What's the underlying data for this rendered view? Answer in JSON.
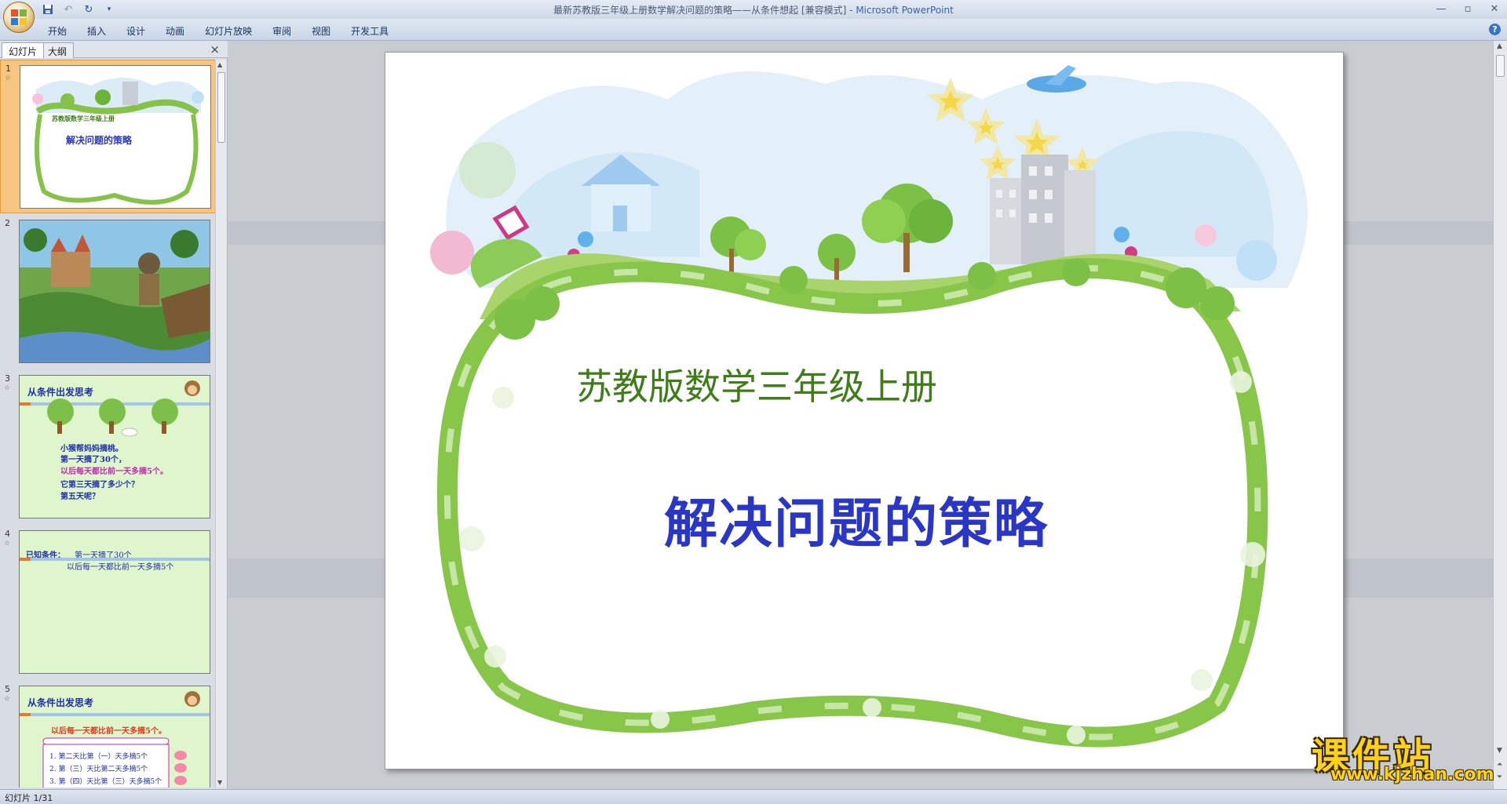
{
  "window": {
    "title": "最新苏教版三年级上册数学解决问题的策略——从条件想起 [兼容模式] - ",
    "app_name": "Microsoft PowerPoint"
  },
  "ribbon": {
    "tabs": [
      "开始",
      "插入",
      "设计",
      "动画",
      "幻灯片放映",
      "审阅",
      "视图",
      "开发工具"
    ]
  },
  "panel": {
    "tab_slides": "幻灯片",
    "tab_outline": "大纲",
    "close": "×"
  },
  "thumbnails": [
    {
      "num": "1",
      "subtitle": "苏教版数学三年级上册",
      "title": "解决问题的策略"
    },
    {
      "num": "2"
    },
    {
      "num": "3",
      "heading": "从条件出发思考",
      "lines": [
        "小猴帮妈妈摘桃。",
        "第一天摘了30个，",
        "以后每天都比前一天多摘5个。",
        "它第三天摘了多少个？",
        "第五天呢？"
      ]
    },
    {
      "num": "4",
      "heading": "已知条件：",
      "line1": "第一天摘了30个",
      "line2": "以后每一天都比前一天多摘5个"
    },
    {
      "num": "5",
      "heading": "从条件出发思考",
      "line1": "以后每一天都比前一天多摘5个。",
      "rows": [
        "1. 第二天比第（一）天多摘5个",
        "2. 第（三）天比第二天多摘5个",
        "3. 第（四）天比第（三）天多摘5个"
      ]
    }
  ],
  "slide": {
    "subtitle": "苏教版数学三年级上册",
    "title": "解决问题的策略"
  },
  "watermark": {
    "cn": "课件站",
    "en": "www.kjzhan.com"
  },
  "status": {
    "slide_counter": "幻灯片 1/31"
  },
  "colors": {
    "subtitle": "#3e7d18",
    "title": "#2a36c5",
    "selected_thumb": "#f7c57f"
  }
}
